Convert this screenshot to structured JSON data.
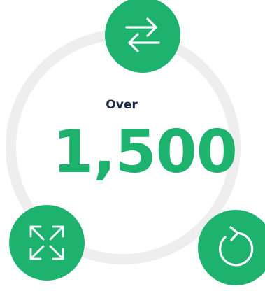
{
  "stat": {
    "prefix": "Over",
    "value": "1,500"
  },
  "icons": {
    "top": "swap-arrows-icon",
    "left": "expand-arrows-icon",
    "right": "refresh-icon"
  },
  "colors": {
    "accent": "#1db36f",
    "heading": "#1e2a4a",
    "ring": "#eeeeee",
    "icon_stroke": "#ffffff"
  }
}
